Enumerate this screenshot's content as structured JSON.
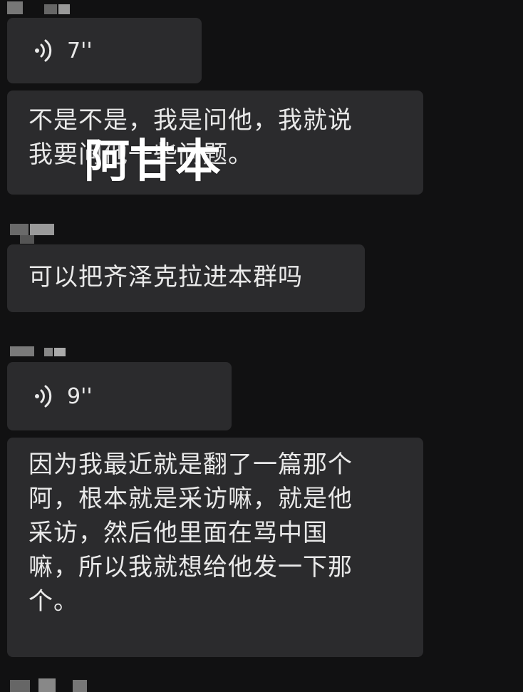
{
  "messages": [
    {
      "type": "voice",
      "duration": "7''"
    },
    {
      "type": "text",
      "lines": [
        "不是不是，我是问他，我就说",
        "我要问他一些问题。"
      ]
    },
    {
      "type": "text",
      "lines": [
        "可以把齐泽克拉进本群吗"
      ]
    },
    {
      "type": "voice",
      "duration": "9''"
    },
    {
      "type": "text",
      "lines": [
        "因为我最近就是翻了一篇那个",
        "阿，根本就是采访嘛，就是他",
        "采访，然后他里面在骂中国",
        "嘛，所以我就想给他发一下那",
        "个。"
      ]
    }
  ],
  "overlay": {
    "text": "阿甘本"
  },
  "colors": {
    "background": "#111112",
    "bubble": "#2b2b2d",
    "text": "#e9e9e9"
  }
}
